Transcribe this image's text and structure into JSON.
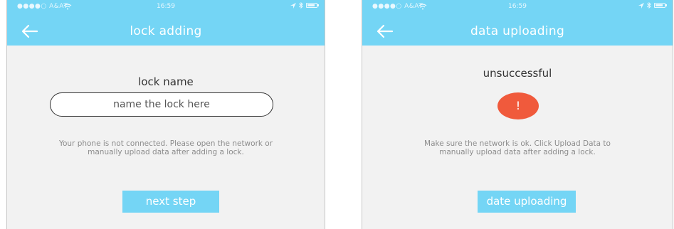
{
  "status_bar": {
    "carrier": "●●●●○ A&AT",
    "time": "16:59"
  },
  "screens": [
    {
      "title": "lock adding",
      "lock_name_label": "lock name",
      "input_placeholder": "name the lock here",
      "message_line1": "Your phone is not connected. Please open the network or",
      "message_line2": "manually upload data after adding a lock.",
      "next_button": "next step"
    },
    {
      "title": "data uploading",
      "result_label": "unsuccessful",
      "alert_symbol": "!",
      "message_line1": "Make sure the network is ok. Click Upload Data to",
      "message_line2": "manually upload data after adding a lock.",
      "upload_button": "date uploading"
    }
  ],
  "colors": {
    "header": "#74d5f5",
    "button": "#74d5f5",
    "alert": "#f05a3c",
    "background": "#f2f2f2"
  },
  "icons": {
    "back": "arrow-left-icon",
    "wifi": "wifi-icon",
    "location": "location-arrow-icon",
    "bluetooth": "bluetooth-icon",
    "battery": "battery-icon",
    "alert": "exclamation-icon"
  }
}
